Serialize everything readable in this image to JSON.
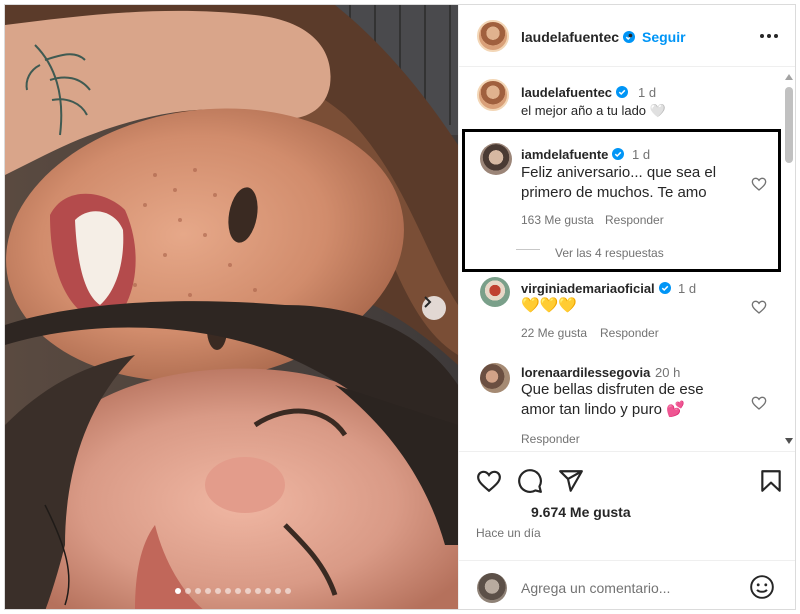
{
  "post": {
    "author": "laudelafuentec",
    "follow_label": "Seguir",
    "separator": "•",
    "likes_text": "9.674 Me gusta",
    "time_ago": "Hace un día",
    "add_comment_placeholder": "Agrega un comentario..."
  },
  "carousel": {
    "slide_count": 12,
    "active_index": 0
  },
  "comments": [
    {
      "user": "laudelafuentec",
      "verified": true,
      "time": "1 d",
      "text": "el mejor año a tu lado",
      "emoji": "🤍"
    },
    {
      "user": "iamdelafuente",
      "verified": true,
      "time": "1 d",
      "text_line1": "Feliz aniversario... que sea el",
      "text_line2": "primero de muchos. Te amo",
      "likes": "163 Me gusta",
      "reply": "Responder",
      "view_replies": "Ver las 4 respuestas",
      "highlighted": true
    },
    {
      "user": "virginiademariaoficial",
      "verified": true,
      "time": "1 d",
      "text": "💛💛💛",
      "likes": "22 Me gusta",
      "reply": "Responder"
    },
    {
      "user": "lorenaardilessegovia",
      "verified": false,
      "time": "20 h",
      "text_line1": "Que bellas disfruten de ese",
      "text_line2": "amor tan lindo y puro 💕",
      "reply": "Responder"
    }
  ],
  "icons": [
    "verified-icon",
    "more-options-icon",
    "heart-icon",
    "comment-icon",
    "share-icon",
    "save-icon",
    "emoji-icon",
    "chevron-right-icon"
  ],
  "colors": {
    "link_blue": "#0095f6",
    "verified_blue": "#0095f6",
    "text": "#262626",
    "muted": "#737373",
    "border": "#dbdbdb"
  }
}
